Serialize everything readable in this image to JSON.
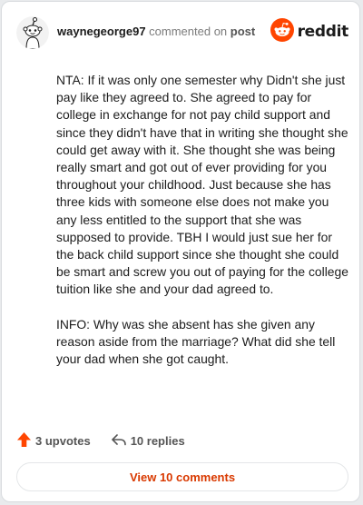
{
  "comment": {
    "username": "waynegeorge97",
    "action_text": "commented on",
    "target_text": "post",
    "paragraphs": [
      "NTA: If it was only one semester why Didn't she just pay like they agreed to. She agreed to pay for college in exchange for not pay child support and since they didn't have that in writing she thought she could get away with it. She thought she was being really smart and got out of ever providing for you throughout your childhood. Just because she has three kids with someone else does not make you any less entitled to the support that she was supposed to provide. TBH I would just sue her for the back child support since she thought she could be smart and screw you out of paying for the college tuition like she and your dad agreed to.",
      "INFO: Why was she absent has she given any reason aside from the marriage? What did she tell your dad when she got caught."
    ],
    "upvotes": "3 upvotes",
    "replies": "10 replies",
    "view_comments": "View 10 comments"
  },
  "brand": {
    "name": "reddit",
    "color": "#ff4500"
  },
  "icons": {
    "avatar": "snoo-avatar",
    "logo": "reddit-logo-icon",
    "upvote": "upvote-arrow-icon",
    "reply": "reply-arrow-icon"
  }
}
